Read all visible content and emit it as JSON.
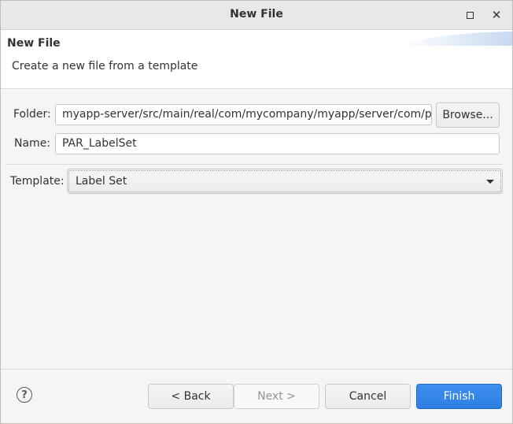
{
  "window": {
    "title": "New File",
    "maximize_icon": "maximize-icon",
    "close_icon": "close-icon",
    "close_glyph": "✕"
  },
  "banner": {
    "title": "New File",
    "description": "Create a new file from a template"
  },
  "form": {
    "folder_label": "Folder:",
    "folder_value": "myapp-server/src/main/real/com/mycompany/myapp/server/com/par",
    "browse_label": "Browse...",
    "name_label": "Name:",
    "name_value": "PAR_LabelSet",
    "template_label": "Template:",
    "template_value": "Label Set"
  },
  "footer": {
    "help_glyph": "?",
    "back_label": "< Back",
    "next_label": "Next >",
    "cancel_label": "Cancel",
    "finish_label": "Finish"
  },
  "colors": {
    "accent": "#3584e4",
    "window_bg": "#f6f5f4",
    "banner_bg": "#ffffff"
  }
}
